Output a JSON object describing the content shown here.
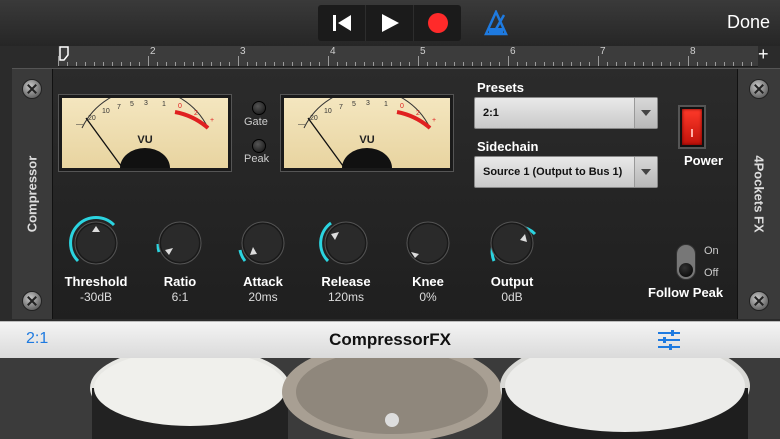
{
  "transport": {
    "rewind_icon": "rewind-to-start-icon",
    "play_icon": "play-icon",
    "record_icon": "record-icon",
    "metronome_icon": "metronome-icon",
    "done_label": "Done",
    "record_color": "#ff2a2a",
    "accent_color": "#1e7ae0"
  },
  "ruler": {
    "numbers": [
      "2",
      "3",
      "4",
      "5",
      "6",
      "7",
      "8"
    ]
  },
  "plugin": {
    "left_title": "Compressor",
    "right_title": "4Pockets FX",
    "meter_label_1": "VU",
    "meter_label_2": "VU",
    "gate_label": "Gate",
    "peak_label": "Peak",
    "presets_label": "Presets",
    "preset_value": "2:1",
    "sidechain_label": "Sidechain",
    "sidechain_value": "Source 1 (Output to Bus 1)",
    "power_label": "Power",
    "toggle_on": "On",
    "toggle_off": "Off",
    "follow_peak_label": "Follow Peak",
    "knobs": [
      {
        "name": "Threshold",
        "value": "-30dB"
      },
      {
        "name": "Ratio",
        "value": "6:1"
      },
      {
        "name": "Attack",
        "value": "20ms"
      },
      {
        "name": "Release",
        "value": "120ms"
      },
      {
        "name": "Knee",
        "value": "0%"
      },
      {
        "name": "Output",
        "value": "0dB"
      }
    ]
  },
  "bottombar": {
    "preset": "2:1",
    "title": "CompressorFX",
    "mixer_icon": "sliders-icon"
  }
}
